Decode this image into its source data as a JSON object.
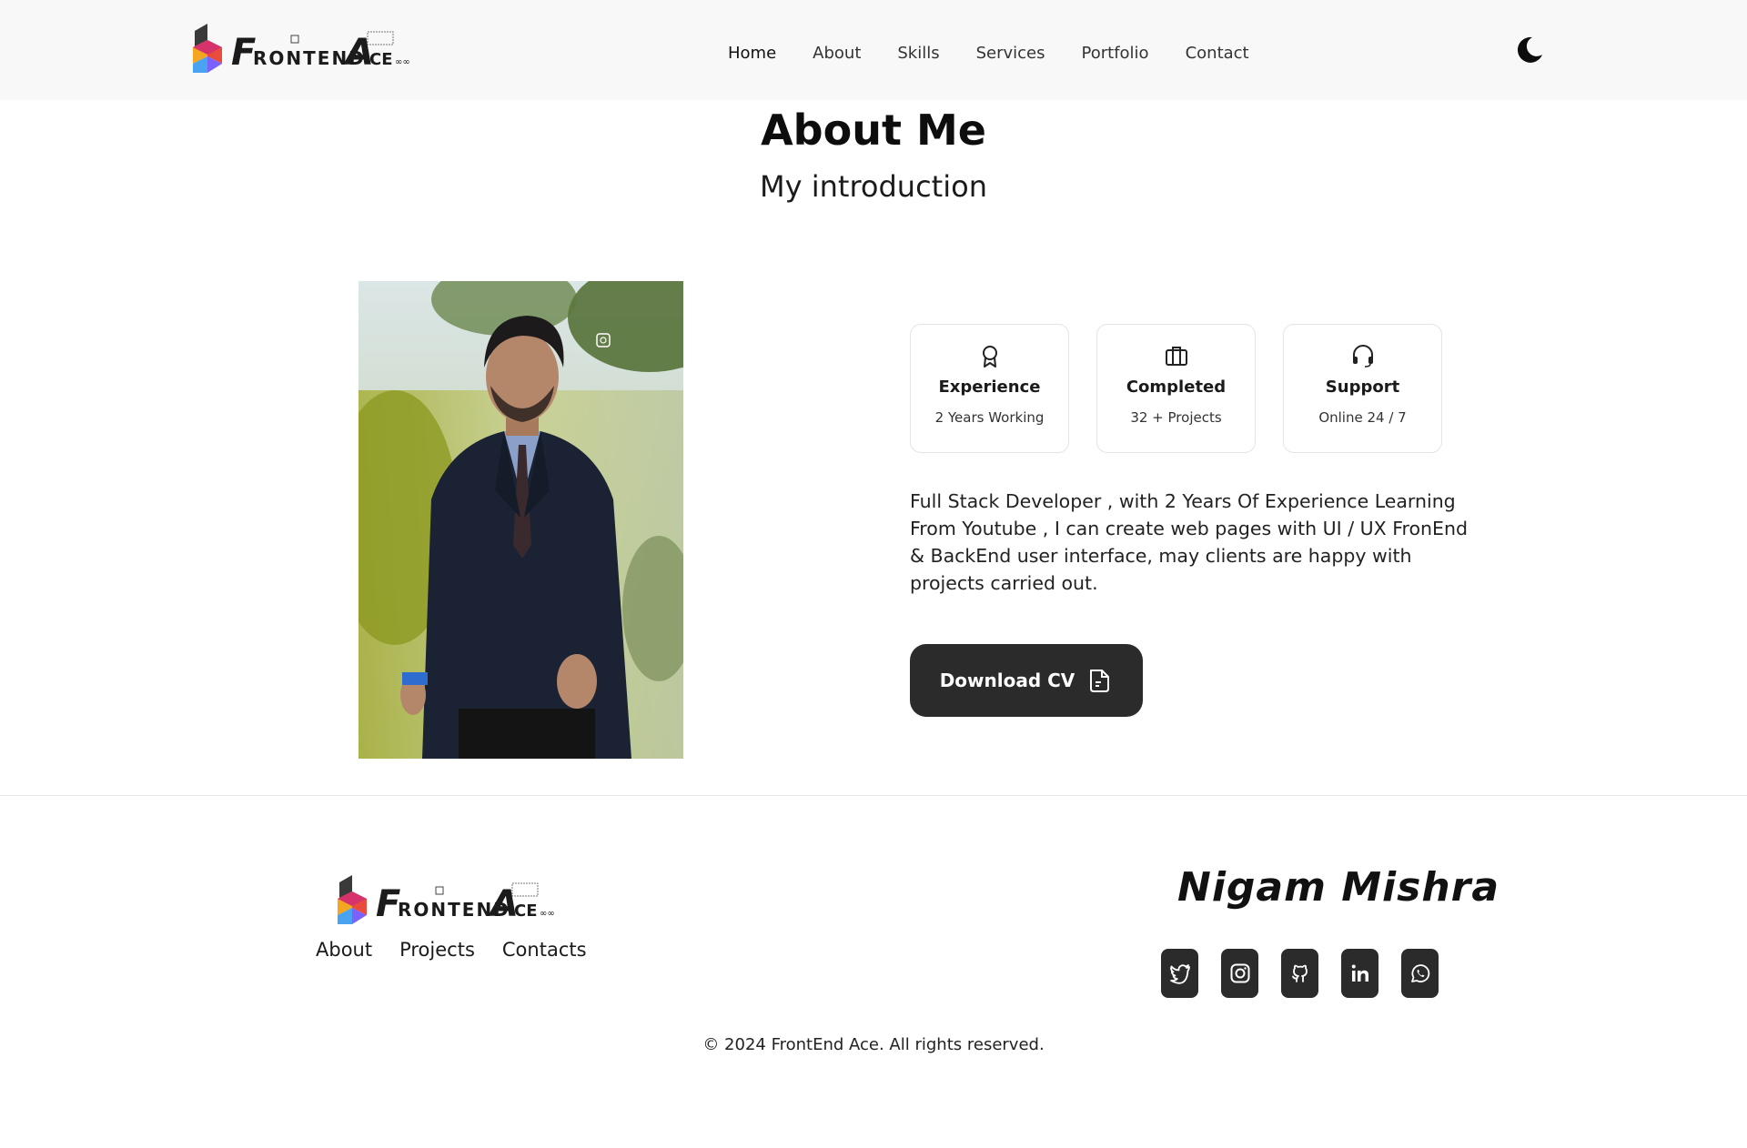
{
  "header": {
    "logo": {
      "text": "FRONTENDACE",
      "alt": "FrontEnd Ace logo"
    },
    "nav": [
      {
        "label": "Home",
        "active": true
      },
      {
        "label": "About"
      },
      {
        "label": "Skills"
      },
      {
        "label": "Services"
      },
      {
        "label": "Portfolio"
      },
      {
        "label": "Contact"
      }
    ],
    "theme_toggle_icon": "moon-icon"
  },
  "about": {
    "title": "About Me",
    "subtitle": "My introduction",
    "cards": [
      {
        "icon": "award-icon",
        "title": "Experience",
        "subtitle": "2 Years Working"
      },
      {
        "icon": "briefcase-icon",
        "title": "Completed",
        "subtitle": "32 + Projects"
      },
      {
        "icon": "headset-icon",
        "title": "Support",
        "subtitle": "Online 24 / 7"
      }
    ],
    "description": "Full Stack Developer , with 2 Years Of Experience Learning From Youtube , I can create web pages with UI / UX FronEnd & BackEnd user interface, may clients are happy with projects carried out.",
    "download_button": {
      "label": "Download CV",
      "icon": "document-icon"
    }
  },
  "footer": {
    "links": [
      "About",
      "Projects",
      "Contacts"
    ],
    "signature": "Nigam Mishra",
    "socials": [
      "twitter-icon",
      "instagram-icon",
      "github-icon",
      "linkedin-icon",
      "whatsapp-icon"
    ],
    "copyright": "© 2024 FrontEnd Ace. All rights reserved."
  },
  "colors": {
    "header_bg": "#f8f8f8",
    "button_bg": "#2b2b2b",
    "card_border": "#e4e4e4"
  }
}
